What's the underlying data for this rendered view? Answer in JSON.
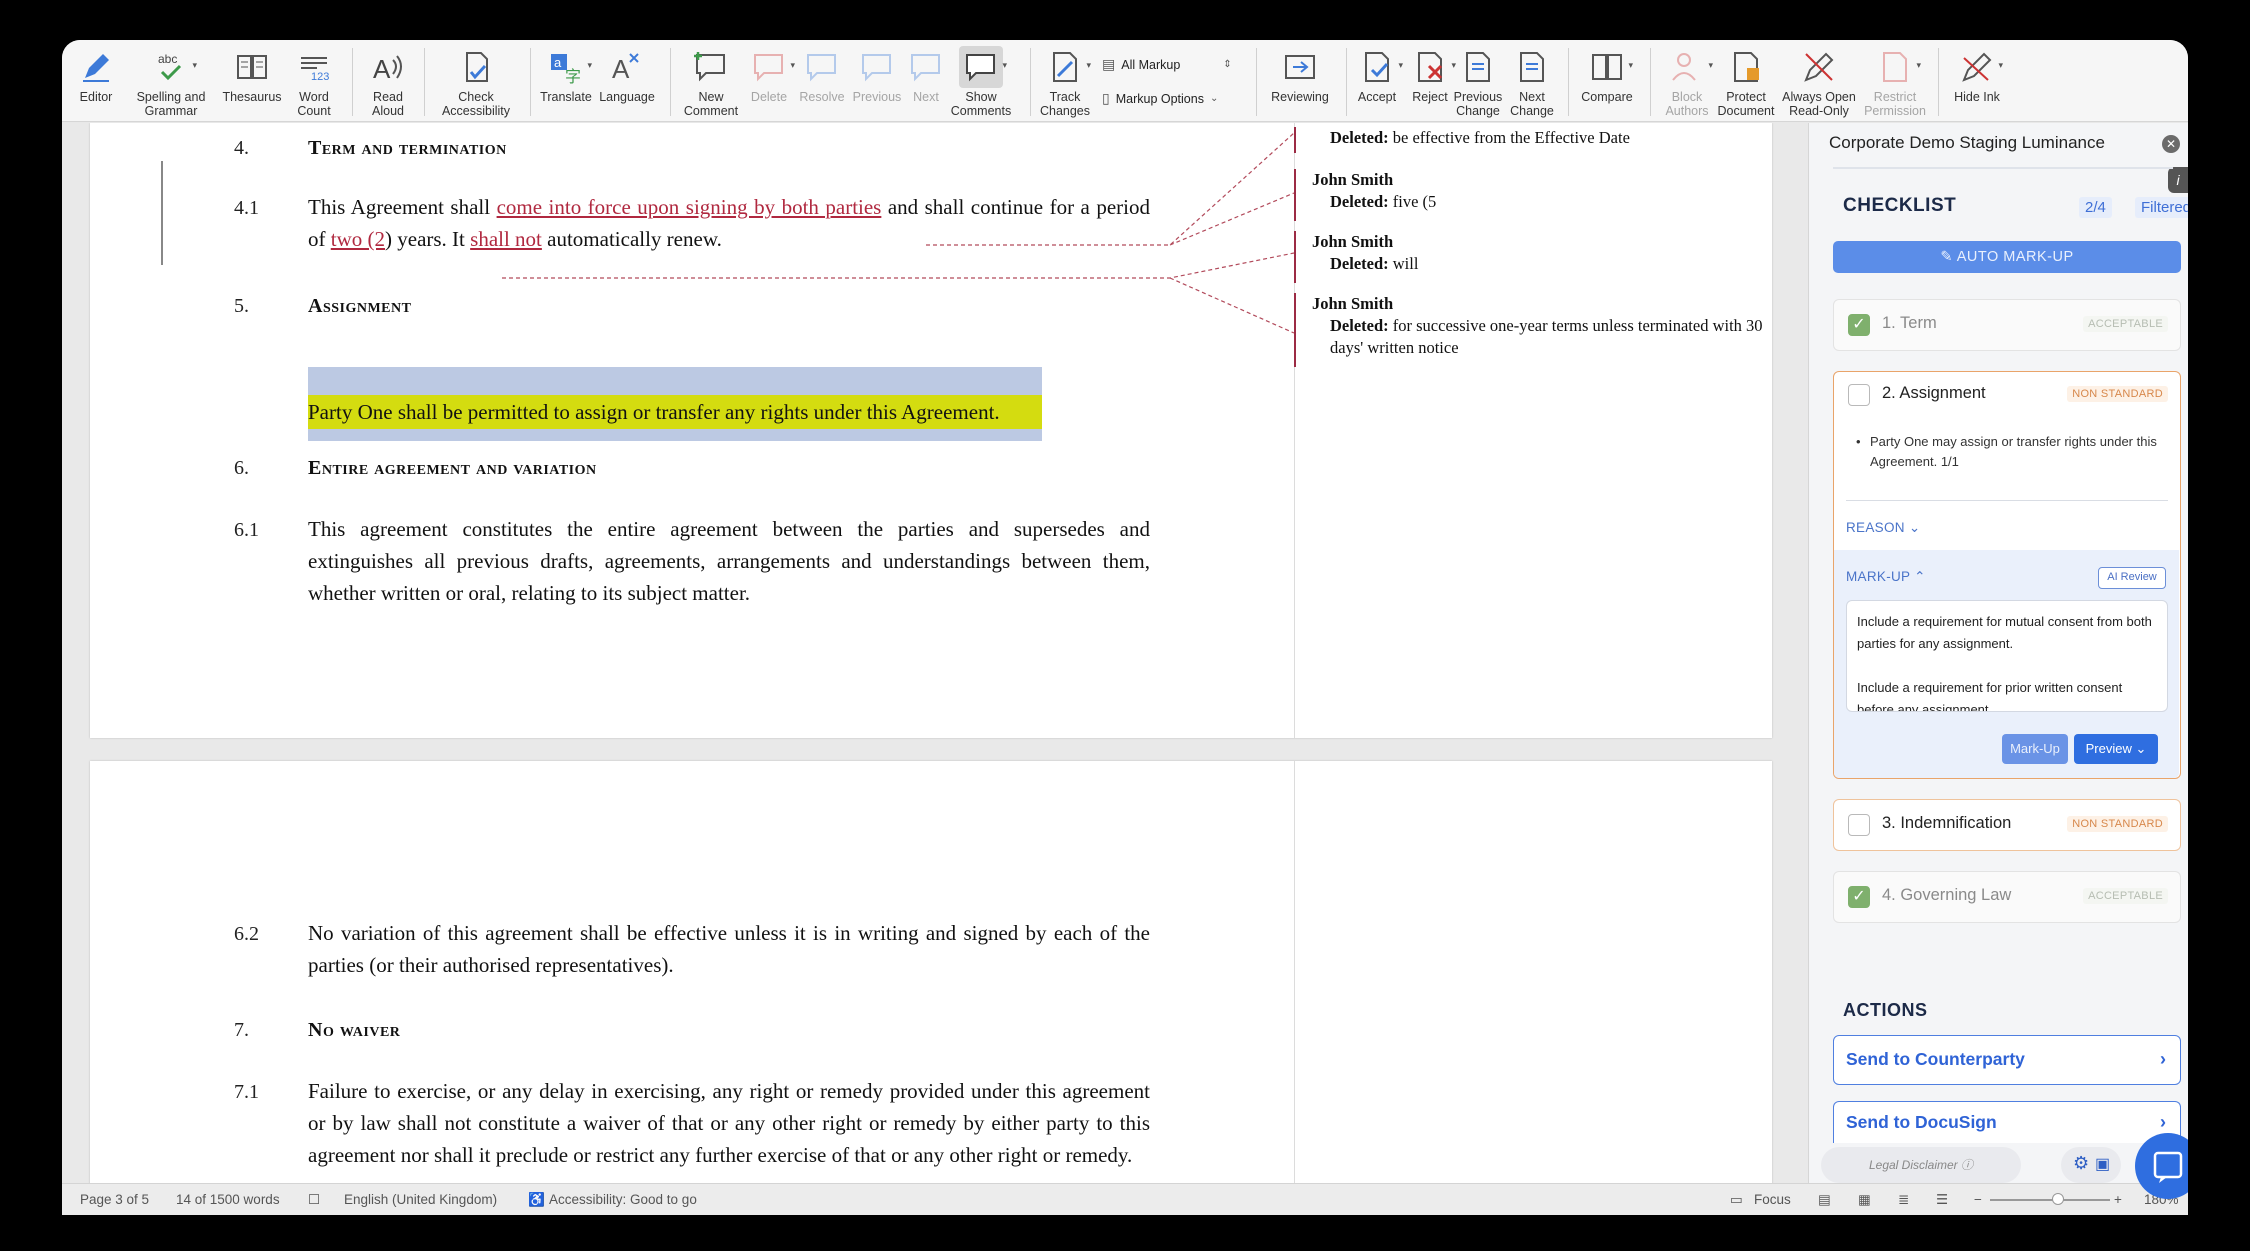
{
  "ribbon": {
    "buttons": [
      {
        "label": "Editor",
        "icon": "editor-pen-icon",
        "disabled": false
      },
      {
        "label": "Spelling and\nGrammar",
        "icon": "spelling-check-icon",
        "disabled": false
      },
      {
        "label": "Thesaurus",
        "icon": "thesaurus-book-icon",
        "disabled": false
      },
      {
        "label": "Word\nCount",
        "icon": "word-count-icon",
        "disabled": false
      },
      {
        "label": "Read\nAloud",
        "icon": "read-aloud-icon",
        "disabled": false
      },
      {
        "label": "Check\nAccessibility",
        "icon": "check-accessibility-icon",
        "disabled": false
      },
      {
        "label": "Translate",
        "icon": "translate-icon",
        "disabled": false
      },
      {
        "label": "Language",
        "icon": "language-icon",
        "disabled": false
      },
      {
        "label": "New\nComment",
        "icon": "new-comment-icon",
        "disabled": false
      },
      {
        "label": "Delete",
        "icon": "delete-comment-icon",
        "disabled": true
      },
      {
        "label": "Resolve",
        "icon": "resolve-comment-icon",
        "disabled": true
      },
      {
        "label": "Previous",
        "icon": "previous-comment-icon",
        "disabled": true
      },
      {
        "label": "Next",
        "icon": "next-comment-icon",
        "disabled": true
      },
      {
        "label": "Show\nComments",
        "icon": "show-comments-icon",
        "disabled": false
      },
      {
        "label": "Track\nChanges",
        "icon": "track-changes-icon",
        "disabled": false
      },
      {
        "label": "Reviewing",
        "icon": "reviewing-pane-icon",
        "disabled": false
      },
      {
        "label": "Accept",
        "icon": "accept-change-icon",
        "disabled": false
      },
      {
        "label": "Reject",
        "icon": "reject-change-icon",
        "disabled": false
      },
      {
        "label": "Previous\nChange",
        "icon": "previous-change-icon",
        "disabled": false
      },
      {
        "label": "Next\nChange",
        "icon": "next-change-icon",
        "disabled": false
      },
      {
        "label": "Compare",
        "icon": "compare-icon",
        "disabled": false
      },
      {
        "label": "Block\nAuthors",
        "icon": "block-authors-icon",
        "disabled": true
      },
      {
        "label": "Protect\nDocument",
        "icon": "protect-document-icon",
        "disabled": false
      },
      {
        "label": "Always Open\nRead-Only",
        "icon": "read-only-icon",
        "disabled": false
      },
      {
        "label": "Restrict\nPermission",
        "icon": "restrict-permission-icon",
        "disabled": true
      },
      {
        "label": "Hide Ink",
        "icon": "hide-ink-icon",
        "disabled": false
      }
    ],
    "markup_select": "All Markup",
    "markup_options": "Markup Options"
  },
  "document": {
    "s4": {
      "num": "4.",
      "title": "Term and termination"
    },
    "p41": {
      "num": "4.1",
      "t1": "This Agreement shall ",
      "i1": "come into force upon signing by both parties",
      "t2": " and shall continue for a period of ",
      "i2": "two (2",
      "t3": ") years. It ",
      "i3": "shall not",
      "t4": " automatically renew."
    },
    "s5": {
      "num": "5.",
      "title": "Assignment"
    },
    "p5": "Party One shall be permitted to assign or transfer any rights under this Agreement.",
    "s6": {
      "num": "6.",
      "title": "Entire agreement and variation"
    },
    "p61": {
      "num": "6.1",
      "text": "This agreement constitutes the entire agreement between the parties and supersedes and extinguishes all previous drafts, agreements, arrangements and understandings between them, whether written or oral, relating to its subject matter."
    },
    "p62": {
      "num": "6.2",
      "text": "No variation of this agreement shall be effective unless it is in writing and signed by each of the parties (or their authorised representatives)."
    },
    "s7": {
      "num": "7.",
      "title": "No waiver"
    },
    "p71": {
      "num": "7.1",
      "text": "Failure to exercise, or any delay in exercising, any right or remedy provided under this agreement or by law shall not constitute a waiver of that or any other right or remedy by either party to this agreement nor shall it preclude or restrict any further exercise of that or any other right or remedy."
    }
  },
  "comments": [
    {
      "author": "",
      "label": "Deleted:",
      "text": "be effective from the Effective Date"
    },
    {
      "author": "John Smith",
      "label": "Deleted:",
      "text": "five (5"
    },
    {
      "author": "John Smith",
      "label": "Deleted:",
      "text": "will"
    },
    {
      "author": "John Smith",
      "label": "Deleted:",
      "text": "for successive one-year terms unless terminated with 30 days' written notice"
    }
  ],
  "status": {
    "page": "Page 3 of 5",
    "words": "14 of 1500 words",
    "language": "English (United Kingdom)",
    "accessibility": "Accessibility: Good to go",
    "focus": "Focus",
    "zoom": "180%"
  },
  "panel": {
    "title": "Corporate Demo Staging Luminance",
    "checklist_title": "CHECKLIST",
    "count": "2/4",
    "filter": "Filtered",
    "auto_markup": "AUTO MARK-UP",
    "items": [
      {
        "label": "1. Term",
        "tag": "ACCEPTABLE",
        "checked": true
      },
      {
        "label": "2. Assignment",
        "tag": "NON STANDARD",
        "checked": false
      },
      {
        "label": "3. Indemnification",
        "tag": "NON STANDARD",
        "checked": false
      },
      {
        "label": "4. Governing Law",
        "tag": "ACCEPTABLE",
        "checked": true
      }
    ],
    "assignment_bullet": "Party One may assign or transfer rights under this Agreement. 1/1",
    "reason_label": "REASON",
    "markup_label": "MARK-UP",
    "ai_review": "AI Review",
    "markup_text": "Include a requirement for mutual consent from both parties for any assignment.\n\nInclude a requirement for prior written consent before any assignment.",
    "markup_btn": "Mark-Up",
    "preview_btn": "Preview",
    "actions_title": "ACTIONS",
    "actions": [
      "Send to Counterparty",
      "Send to DocuSign"
    ],
    "disclaimer": "Legal Disclaimer"
  },
  "colors": {
    "accent": "#2f6ee0",
    "insertion": "#b0283f",
    "highlight": "#d4dc10",
    "selection": "#bcc9e3"
  }
}
